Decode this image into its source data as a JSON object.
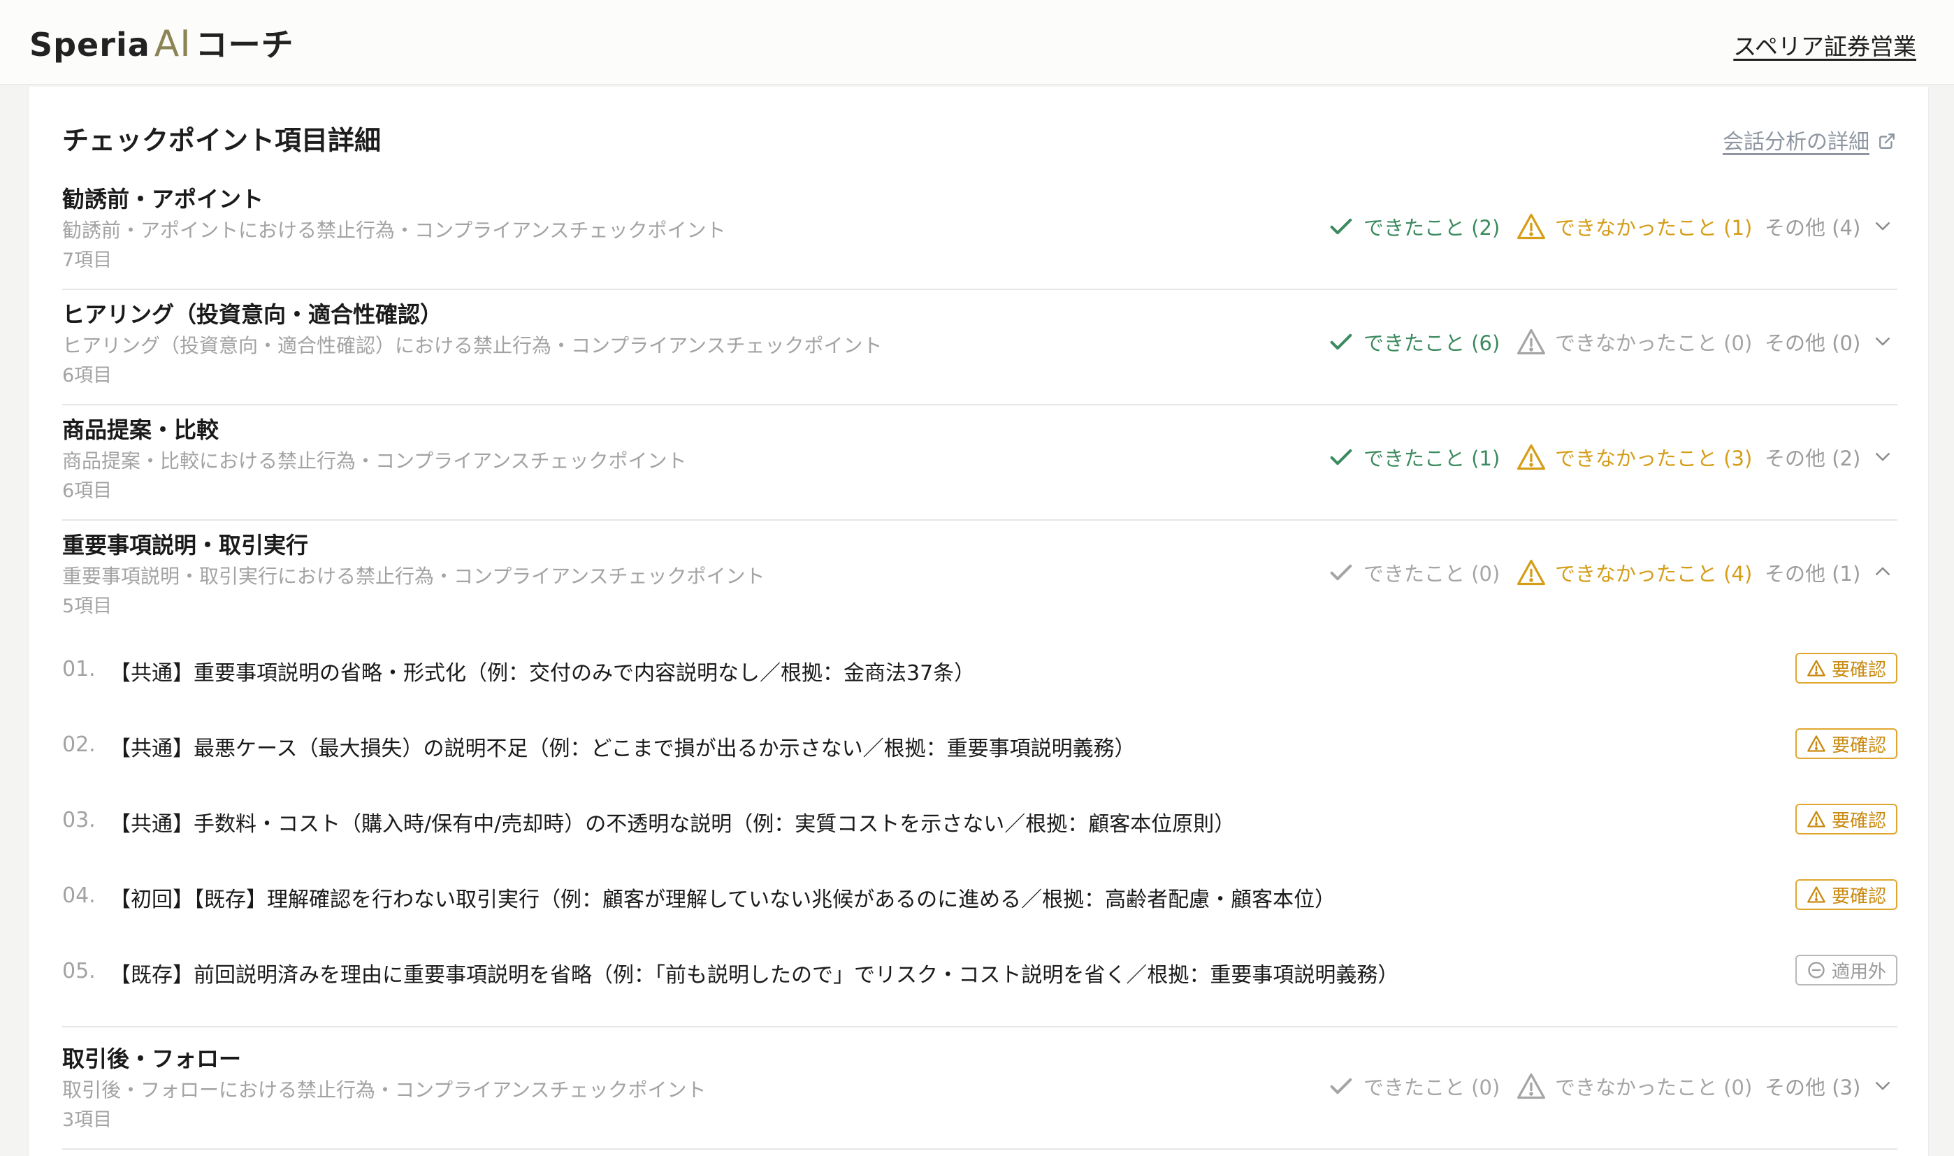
{
  "header": {
    "logo_prefix": "Speria",
    "logo_ai": "AI",
    "logo_suffix": "コーチ",
    "firm_link": "スペリア証券営業"
  },
  "card": {
    "title": "チェックポイント項目詳細",
    "detail_link": "会話分析の詳細"
  },
  "sections": [
    {
      "name": "勧誘前・アポイント",
      "desc": "勧誘前・アポイントにおける禁止行為・コンプライアンスチェックポイント",
      "count": "7項目",
      "ok": "できたこと (2)",
      "ng": "できなかったこと (1)",
      "other": "その他 (4)"
    },
    {
      "name": "ヒアリング（投資意向・適合性確認）",
      "desc": "ヒアリング（投資意向・適合性確認）における禁止行為・コンプライアンスチェックポイント",
      "count": "6項目",
      "ok": "できたこと (6)",
      "ng": "できなかったこと (0)",
      "other": "その他 (0)"
    },
    {
      "name": "商品提案・比較",
      "desc": "商品提案・比較における禁止行為・コンプライアンスチェックポイント",
      "count": "6項目",
      "ok": "できたこと (1)",
      "ng": "できなかったこと (3)",
      "other": "その他 (2)"
    },
    {
      "name": "重要事項説明・取引実行",
      "desc": "重要事項説明・取引実行における禁止行為・コンプライアンスチェックポイント",
      "count": "5項目",
      "ok": "できたこと (0)",
      "ng": "できなかったこと (4)",
      "other": "その他 (1)"
    },
    {
      "name": "取引後・フォロー",
      "desc": "取引後・フォローにおける禁止行為・コンプライアンスチェックポイント",
      "count": "3項目",
      "ok": "できたこと (0)",
      "ng": "できなかったこと (0)",
      "other": "その他 (3)"
    }
  ],
  "items": [
    {
      "num": "01.",
      "text": "【共通】重要事項説明の省略・形式化（例：交付のみで内容説明なし／根拠：金商法37条）",
      "badge": "要確認"
    },
    {
      "num": "02.",
      "text": "【共通】最悪ケース（最大損失）の説明不足（例：どこまで損が出るか示さない／根拠：重要事項説明義務）",
      "badge": "要確認"
    },
    {
      "num": "03.",
      "text": "【共通】手数料・コスト（購入時/保有中/売却時）の不透明な説明（例：実質コストを示さない／根拠：顧客本位原則）",
      "badge": "要確認"
    },
    {
      "num": "04.",
      "text": "【初回】【既存】理解確認を行わない取引実行（例：顧客が理解していない兆候があるのに進める／根拠：高齢者配慮・顧客本位）",
      "badge": "要確認"
    },
    {
      "num": "05.",
      "text": "【既存】前回説明済みを理由に重要事項説明を省略（例：「前も説明したので」でリスク・コスト説明を省く／根拠：重要事項説明義務）",
      "badge": "適用外"
    }
  ],
  "colors": {
    "ok": "#3c8a5f",
    "warn": "#d59d18",
    "muted": "#a5a5a5",
    "logo_accent": "#8c8455"
  }
}
